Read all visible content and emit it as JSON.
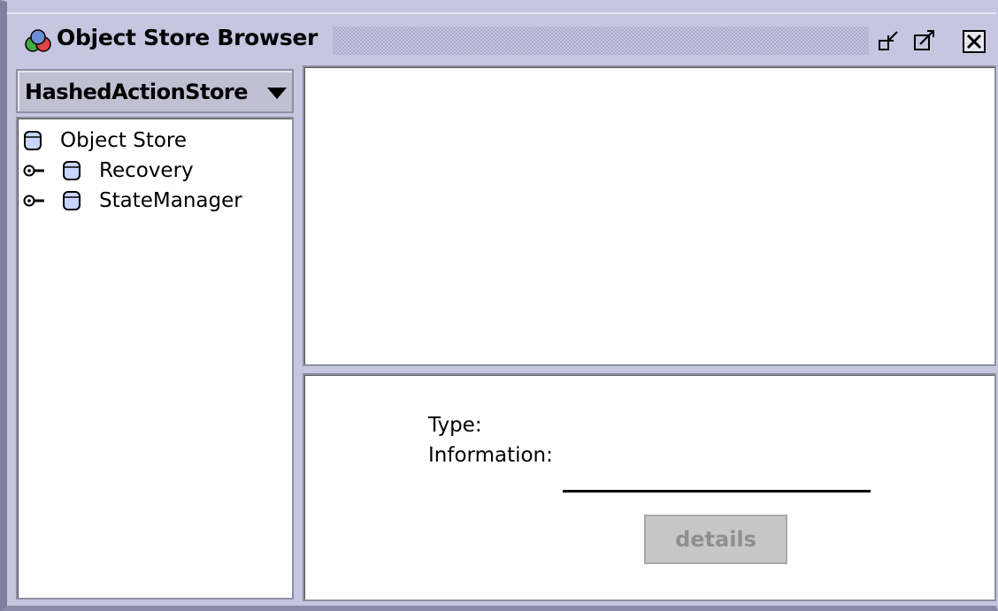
{
  "window": {
    "title": "Object Store Browser",
    "icon": "object-store-app-icon",
    "buttons": [
      {
        "name": "iconify-button",
        "icon": "iconify-icon"
      },
      {
        "name": "maximize-button",
        "icon": "maximize-icon"
      },
      {
        "name": "close-button",
        "icon": "close-icon"
      }
    ]
  },
  "store_selector": {
    "selected": "HashedActionStore",
    "icon": "chevron-down-icon"
  },
  "tree": {
    "root": {
      "label": "Object Store",
      "icon": "database-icon"
    },
    "children": [
      {
        "label": "Recovery",
        "icon": "database-icon",
        "expand_icon": "tree-expand-handle-icon"
      },
      {
        "label": "StateManager",
        "icon": "database-icon",
        "expand_icon": "tree-expand-handle-icon"
      }
    ]
  },
  "info_panel": {
    "type_label": "Type:",
    "information_label": "Information:",
    "details_button": "details"
  },
  "colors": {
    "frame": "#c6c6e0",
    "panel_border": "#8e8ea4",
    "disabled_button": "#c7c7c7",
    "disabled_text": "#8f8f8f"
  }
}
